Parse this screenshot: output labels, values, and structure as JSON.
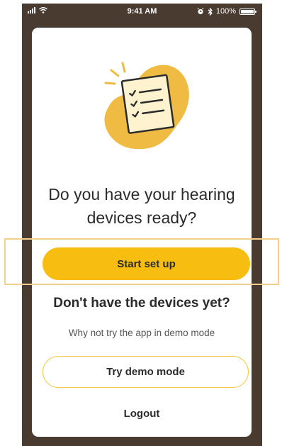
{
  "status_bar": {
    "time": "9:41 AM",
    "battery": "100%",
    "icons": [
      "signal-icon",
      "wifi-icon",
      "alarm-icon",
      "bluetooth-icon",
      "battery-icon"
    ]
  },
  "illustration": {
    "icon": "checklist-icon",
    "colors": {
      "blob": "#efbb43",
      "paper": "#fff3cf",
      "ink": "#2b2b2b"
    }
  },
  "main": {
    "heading_line1": "Do you have your hearing",
    "heading_line2": "devices ready?",
    "start_button_label": "Start set up",
    "no_devices_heading": "Don't have the devices yet?",
    "demo_hint": "Why not try the app in demo mode",
    "demo_button_label": "Try demo mode",
    "logout_label": "Logout"
  },
  "colors": {
    "frame": "#4a3b31",
    "accent": "#f7bd10",
    "outline": "#f4c84a",
    "highlight": "#f6cf8e"
  }
}
